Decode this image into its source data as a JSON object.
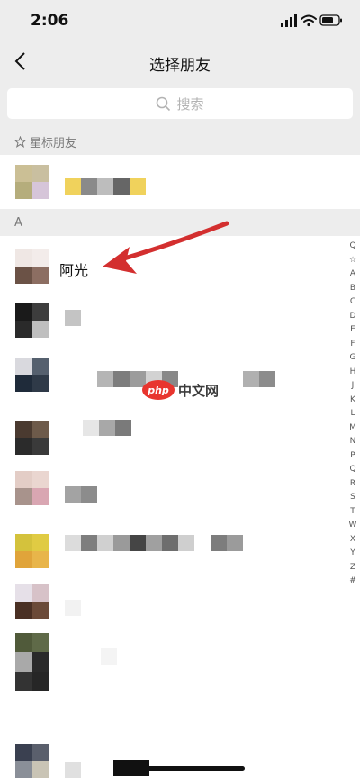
{
  "status_bar": {
    "time": "2:06"
  },
  "nav": {
    "title": "选择朋友"
  },
  "search": {
    "placeholder": "搜索"
  },
  "sections": {
    "starred": "星标朋友",
    "a": "A"
  },
  "contacts": {
    "highlighted_name": "阿光"
  },
  "index_letters": [
    "Q",
    "☆",
    "A",
    "B",
    "C",
    "D",
    "E",
    "F",
    "G",
    "H",
    "J",
    "K",
    "L",
    "M",
    "N",
    "P",
    "Q",
    "R",
    "S",
    "T",
    "W",
    "X",
    "Y",
    "Z",
    "#"
  ],
  "watermark": {
    "logo": "php",
    "text": "中文网"
  },
  "colors": {
    "background": "#ededed",
    "arrow": "#d32f2f",
    "watermark_red": "#e8352e"
  }
}
